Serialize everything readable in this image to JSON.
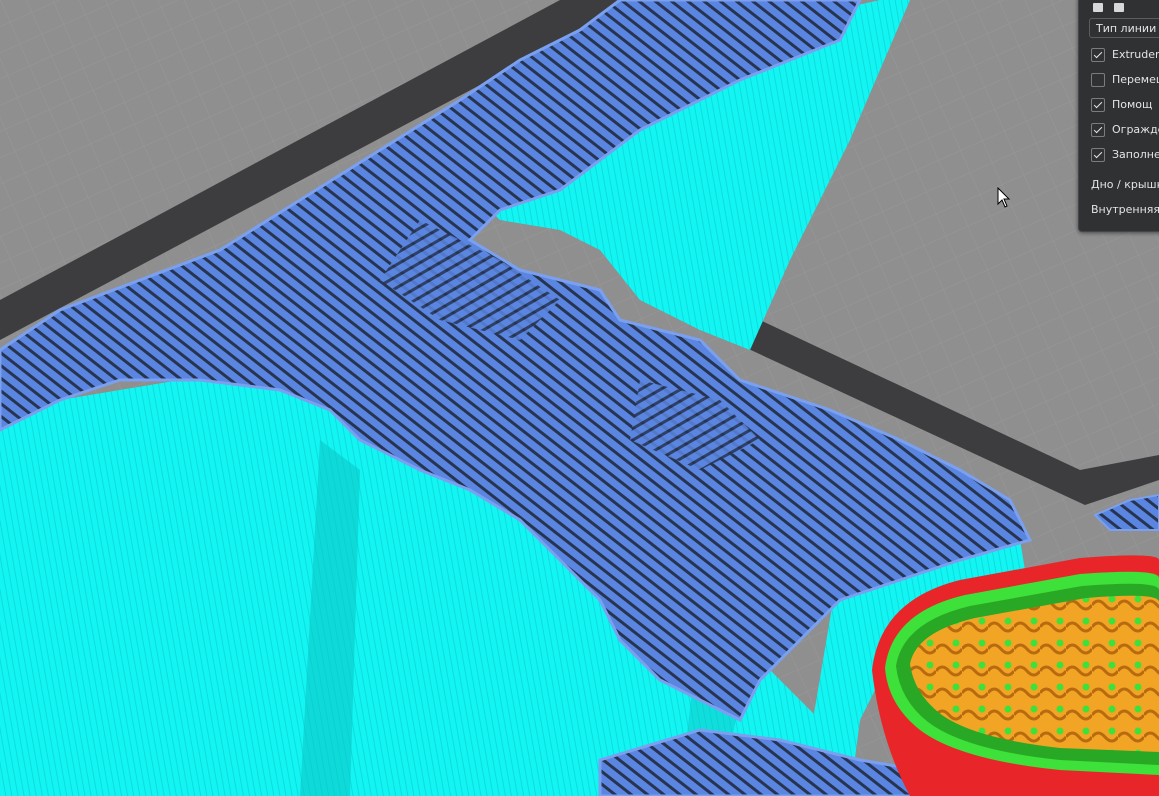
{
  "panel": {
    "dropdown_value": "Тип линии",
    "items": [
      {
        "label": "Extruder",
        "checked": true
      },
      {
        "label": "Перемещ",
        "checked": false
      },
      {
        "label": "Помощ",
        "checked": true
      },
      {
        "label": "Огражде",
        "checked": true
      },
      {
        "label": "Заполне",
        "checked": true
      }
    ],
    "bottom_label": "Дно / крышк",
    "inner_label": "Внутренняя"
  },
  "colors": {
    "build_plate": "#8f8f8f",
    "plate_border": "#3d3d3f",
    "support": "#12f5f2",
    "support_shadow": "#0bc8c8",
    "top_skin": "#5a85e0",
    "skin_line": "#26344f",
    "wall_outer": "#e8262a",
    "wall_inner": "#3ee03a",
    "infill": "#f2a524",
    "panel_bg": "#2f3133"
  },
  "icons": [
    "cube-icon",
    "layers-icon",
    "cursor-icon",
    "checkmark-icon"
  ]
}
